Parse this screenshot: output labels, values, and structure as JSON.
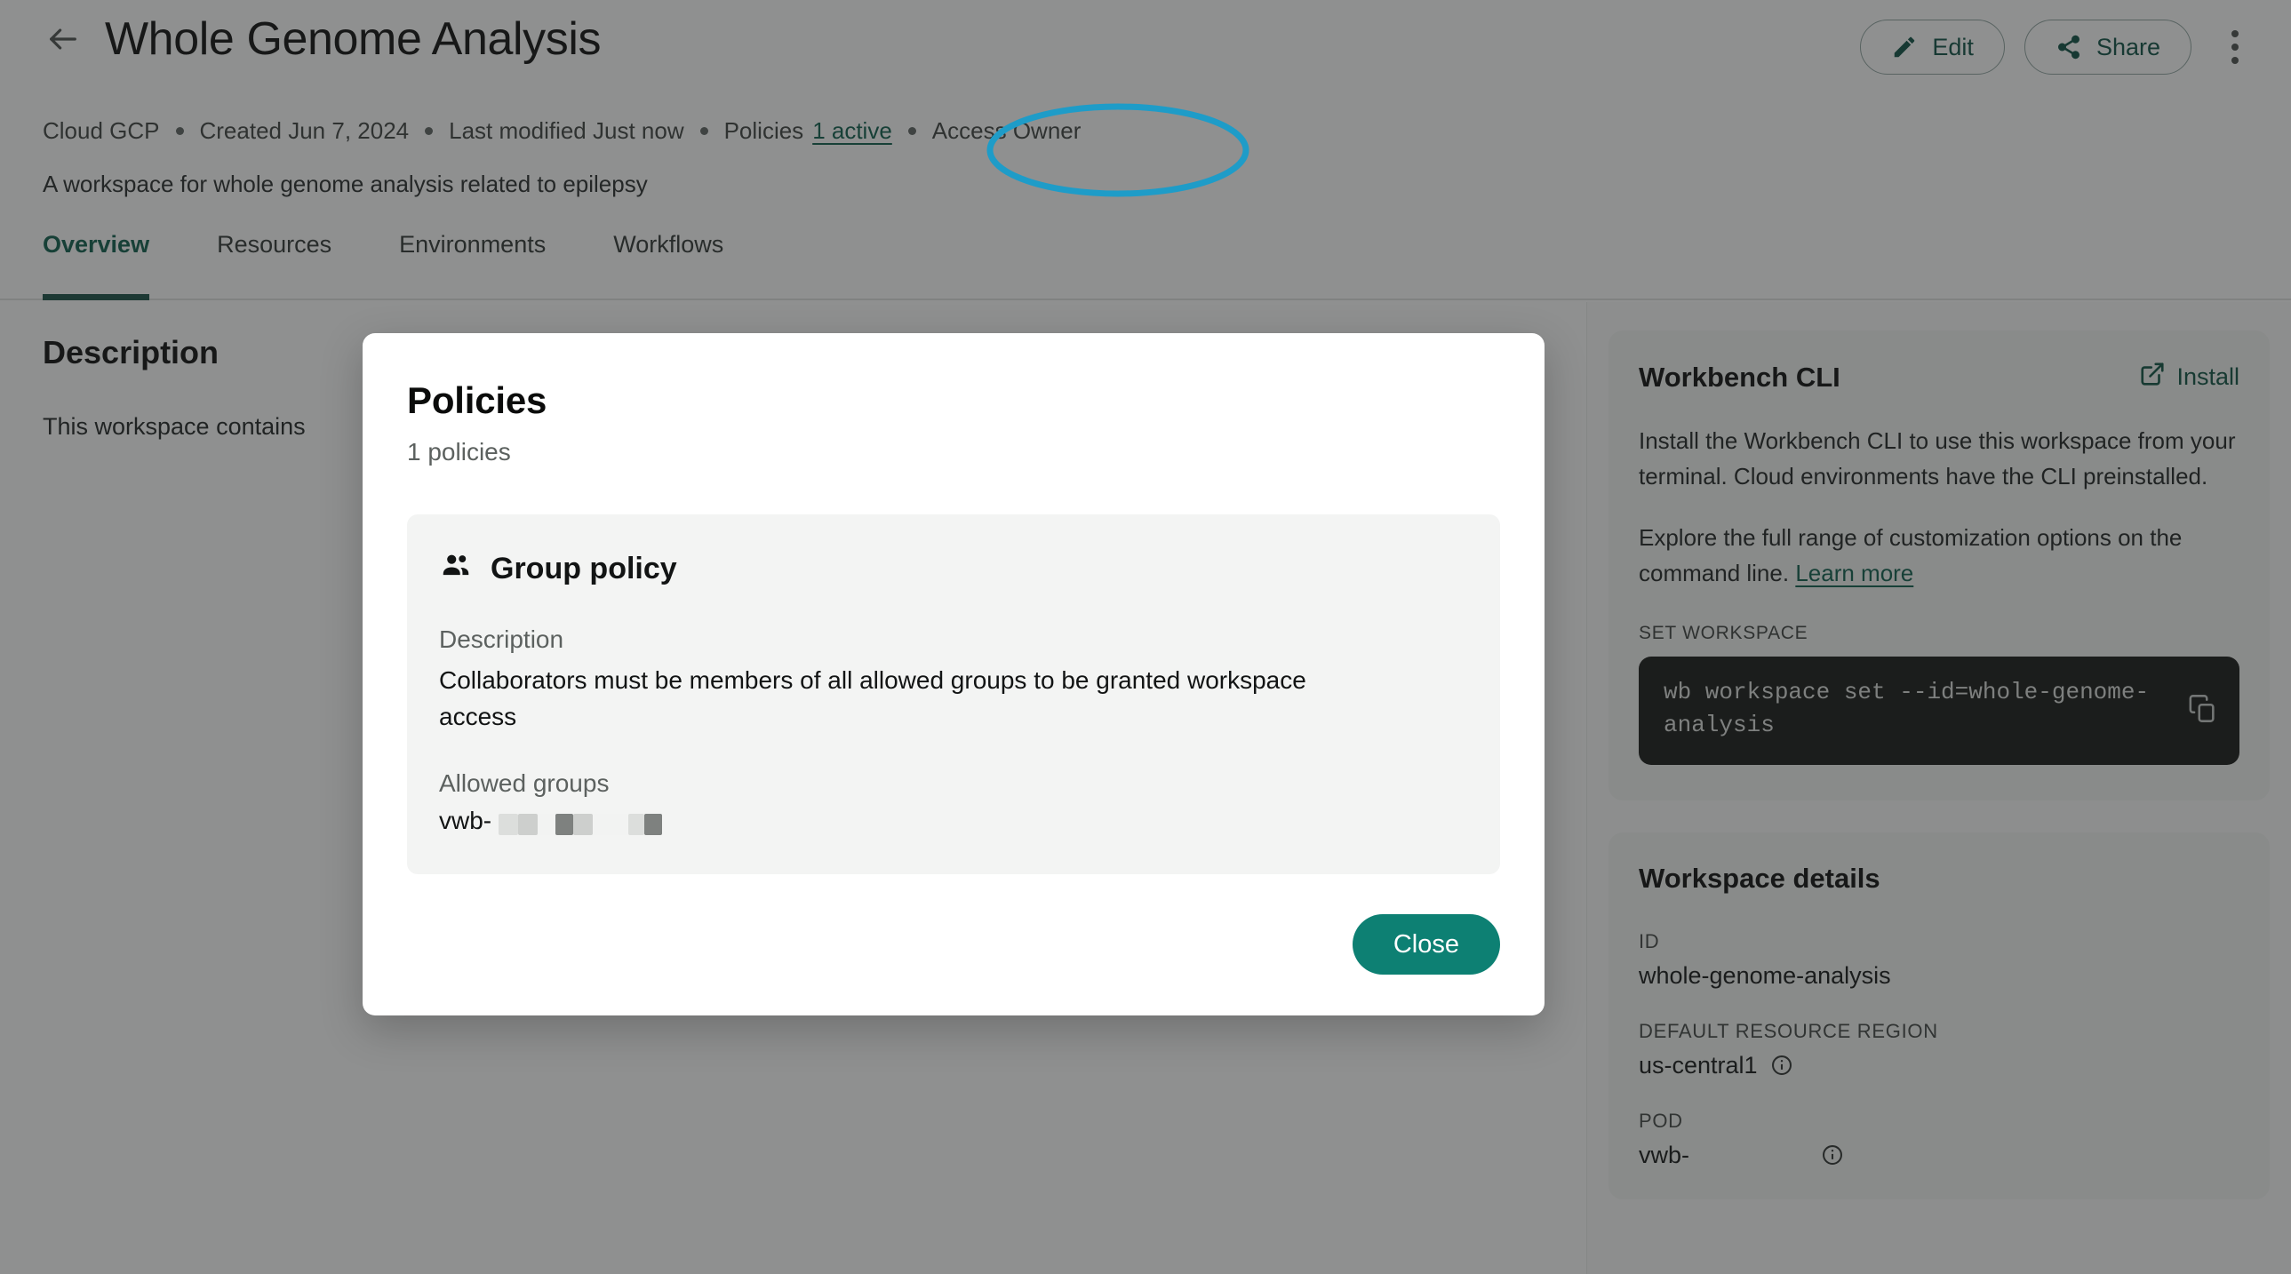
{
  "header": {
    "back_icon": "arrow-left-icon",
    "title": "Whole Genome Analysis",
    "edit_label": "Edit",
    "share_label": "Share",
    "more_icon": "more-vertical-icon",
    "meta": {
      "cloud": "Cloud GCP",
      "created": "Created Jun 7, 2024",
      "modified": "Last modified Just now",
      "policies_label": "Policies",
      "policies_link": "1 active",
      "access": "Access Owner"
    },
    "subtitle": "A workspace for whole genome analysis related to epilepsy",
    "tabs": [
      {
        "label": "Overview",
        "active": true
      },
      {
        "label": "Resources",
        "active": false
      },
      {
        "label": "Environments",
        "active": false
      },
      {
        "label": "Workflows",
        "active": false
      }
    ]
  },
  "main": {
    "description_heading": "Description",
    "description_body": "This workspace contains"
  },
  "right_rail": {
    "cli_card": {
      "title": "Workbench CLI",
      "install_label": "Install",
      "install_icon": "external-link-icon",
      "paragraph_1": "Install the Workbench CLI to use this workspace from your terminal. Cloud environments have the CLI preinstalled.",
      "paragraph_2_lead": "Explore the full range of customization options on the command line. ",
      "learn_more_label": "Learn more",
      "code_eyebrow": "SET WORKSPACE",
      "code_command": "wb workspace set --id=whole-genome-analysis",
      "copy_icon": "copy-icon"
    },
    "details_card": {
      "title": "Workspace details",
      "fields": [
        {
          "label": "ID",
          "value": "whole-genome-analysis",
          "info": false
        },
        {
          "label": "DEFAULT RESOURCE REGION",
          "value": "us-central1",
          "info": true
        },
        {
          "label": "POD",
          "value": "vwb-",
          "info": true
        }
      ]
    }
  },
  "modal": {
    "title": "Policies",
    "subtitle": "1 policies",
    "policy": {
      "icon": "group-icon",
      "name": "Group policy",
      "description_label": "Description",
      "description_value": "Collaborators must be members of all allowed groups to be granted workspace access",
      "groups_label": "Allowed groups",
      "groups_value": "vwb-"
    },
    "close_label": "Close"
  },
  "annotation": {
    "shape": "ellipse",
    "color": "#1e9cc8",
    "target": "Policies 1 active"
  },
  "colors": {
    "brand_green": "#0b5c4b",
    "accent_teal": "#0d8073",
    "annotation_blue": "#1e9cc8",
    "scrim": "rgba(36,38,37,0.51)",
    "card_gray": "#f3f4f3",
    "code_bg": "#131513"
  }
}
